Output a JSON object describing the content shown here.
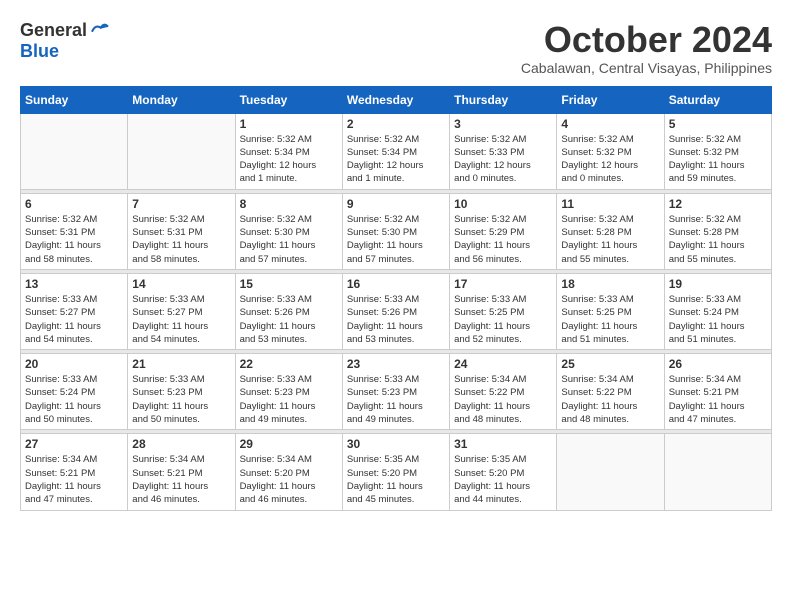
{
  "logo": {
    "general": "General",
    "blue": "Blue"
  },
  "title": "October 2024",
  "location": "Cabalawan, Central Visayas, Philippines",
  "weekdays": [
    "Sunday",
    "Monday",
    "Tuesday",
    "Wednesday",
    "Thursday",
    "Friday",
    "Saturday"
  ],
  "weeks": [
    [
      {
        "day": "",
        "info": ""
      },
      {
        "day": "",
        "info": ""
      },
      {
        "day": "1",
        "info": "Sunrise: 5:32 AM\nSunset: 5:34 PM\nDaylight: 12 hours\nand 1 minute."
      },
      {
        "day": "2",
        "info": "Sunrise: 5:32 AM\nSunset: 5:34 PM\nDaylight: 12 hours\nand 1 minute."
      },
      {
        "day": "3",
        "info": "Sunrise: 5:32 AM\nSunset: 5:33 PM\nDaylight: 12 hours\nand 0 minutes."
      },
      {
        "day": "4",
        "info": "Sunrise: 5:32 AM\nSunset: 5:32 PM\nDaylight: 12 hours\nand 0 minutes."
      },
      {
        "day": "5",
        "info": "Sunrise: 5:32 AM\nSunset: 5:32 PM\nDaylight: 11 hours\nand 59 minutes."
      }
    ],
    [
      {
        "day": "6",
        "info": "Sunrise: 5:32 AM\nSunset: 5:31 PM\nDaylight: 11 hours\nand 58 minutes."
      },
      {
        "day": "7",
        "info": "Sunrise: 5:32 AM\nSunset: 5:31 PM\nDaylight: 11 hours\nand 58 minutes."
      },
      {
        "day": "8",
        "info": "Sunrise: 5:32 AM\nSunset: 5:30 PM\nDaylight: 11 hours\nand 57 minutes."
      },
      {
        "day": "9",
        "info": "Sunrise: 5:32 AM\nSunset: 5:30 PM\nDaylight: 11 hours\nand 57 minutes."
      },
      {
        "day": "10",
        "info": "Sunrise: 5:32 AM\nSunset: 5:29 PM\nDaylight: 11 hours\nand 56 minutes."
      },
      {
        "day": "11",
        "info": "Sunrise: 5:32 AM\nSunset: 5:28 PM\nDaylight: 11 hours\nand 55 minutes."
      },
      {
        "day": "12",
        "info": "Sunrise: 5:32 AM\nSunset: 5:28 PM\nDaylight: 11 hours\nand 55 minutes."
      }
    ],
    [
      {
        "day": "13",
        "info": "Sunrise: 5:33 AM\nSunset: 5:27 PM\nDaylight: 11 hours\nand 54 minutes."
      },
      {
        "day": "14",
        "info": "Sunrise: 5:33 AM\nSunset: 5:27 PM\nDaylight: 11 hours\nand 54 minutes."
      },
      {
        "day": "15",
        "info": "Sunrise: 5:33 AM\nSunset: 5:26 PM\nDaylight: 11 hours\nand 53 minutes."
      },
      {
        "day": "16",
        "info": "Sunrise: 5:33 AM\nSunset: 5:26 PM\nDaylight: 11 hours\nand 53 minutes."
      },
      {
        "day": "17",
        "info": "Sunrise: 5:33 AM\nSunset: 5:25 PM\nDaylight: 11 hours\nand 52 minutes."
      },
      {
        "day": "18",
        "info": "Sunrise: 5:33 AM\nSunset: 5:25 PM\nDaylight: 11 hours\nand 51 minutes."
      },
      {
        "day": "19",
        "info": "Sunrise: 5:33 AM\nSunset: 5:24 PM\nDaylight: 11 hours\nand 51 minutes."
      }
    ],
    [
      {
        "day": "20",
        "info": "Sunrise: 5:33 AM\nSunset: 5:24 PM\nDaylight: 11 hours\nand 50 minutes."
      },
      {
        "day": "21",
        "info": "Sunrise: 5:33 AM\nSunset: 5:23 PM\nDaylight: 11 hours\nand 50 minutes."
      },
      {
        "day": "22",
        "info": "Sunrise: 5:33 AM\nSunset: 5:23 PM\nDaylight: 11 hours\nand 49 minutes."
      },
      {
        "day": "23",
        "info": "Sunrise: 5:33 AM\nSunset: 5:23 PM\nDaylight: 11 hours\nand 49 minutes."
      },
      {
        "day": "24",
        "info": "Sunrise: 5:34 AM\nSunset: 5:22 PM\nDaylight: 11 hours\nand 48 minutes."
      },
      {
        "day": "25",
        "info": "Sunrise: 5:34 AM\nSunset: 5:22 PM\nDaylight: 11 hours\nand 48 minutes."
      },
      {
        "day": "26",
        "info": "Sunrise: 5:34 AM\nSunset: 5:21 PM\nDaylight: 11 hours\nand 47 minutes."
      }
    ],
    [
      {
        "day": "27",
        "info": "Sunrise: 5:34 AM\nSunset: 5:21 PM\nDaylight: 11 hours\nand 47 minutes."
      },
      {
        "day": "28",
        "info": "Sunrise: 5:34 AM\nSunset: 5:21 PM\nDaylight: 11 hours\nand 46 minutes."
      },
      {
        "day": "29",
        "info": "Sunrise: 5:34 AM\nSunset: 5:20 PM\nDaylight: 11 hours\nand 46 minutes."
      },
      {
        "day": "30",
        "info": "Sunrise: 5:35 AM\nSunset: 5:20 PM\nDaylight: 11 hours\nand 45 minutes."
      },
      {
        "day": "31",
        "info": "Sunrise: 5:35 AM\nSunset: 5:20 PM\nDaylight: 11 hours\nand 44 minutes."
      },
      {
        "day": "",
        "info": ""
      },
      {
        "day": "",
        "info": ""
      }
    ]
  ]
}
